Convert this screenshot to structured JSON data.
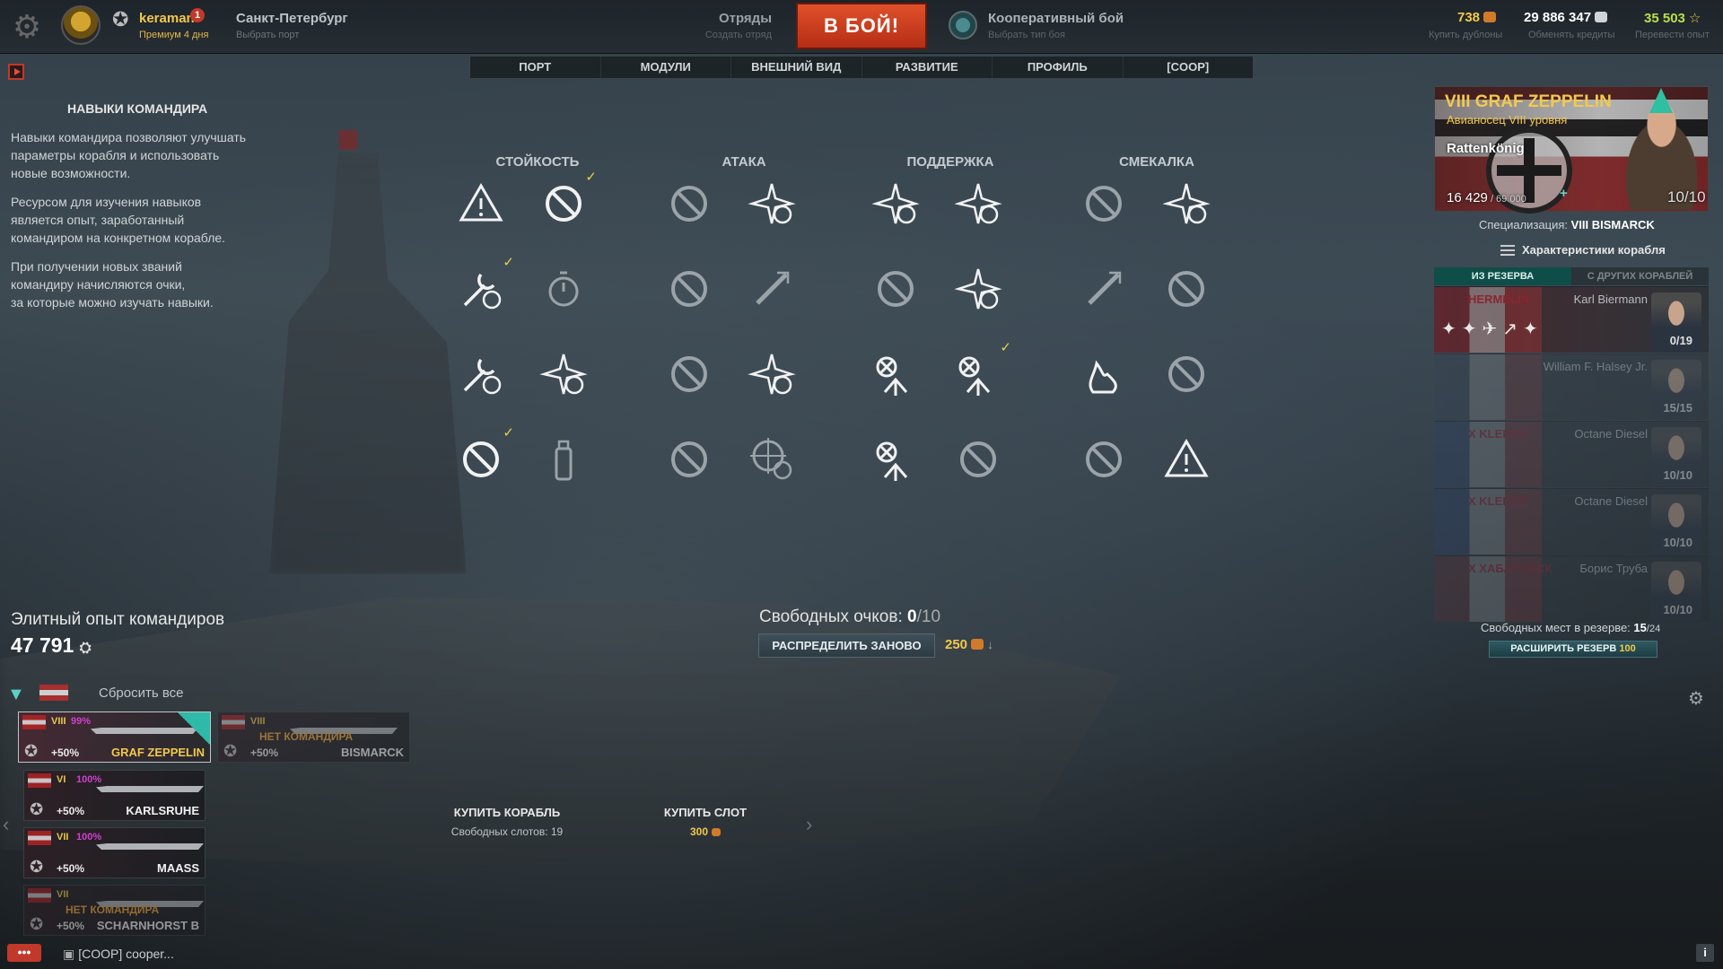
{
  "topbar": {
    "username": "keraman",
    "notification_count": "1",
    "premium": "Премиум 4 дня",
    "port_name": "Санкт-Петербург",
    "port_sub": "Выбрать порт",
    "squads": "Отряды",
    "squads_sub": "Создать отряд",
    "battle_button": "В БОЙ!",
    "mode_name": "Кооперативный бой",
    "mode_sub": "Выбрать тип боя",
    "doubloons": "738",
    "doubloons_sub": "Купить дублоны",
    "credits": "29 886 347",
    "credits_sub": "Обменять кредиты",
    "free_xp": "35 503",
    "free_xp_sub": "Перевести опыт"
  },
  "tabs": [
    "ПОРТ",
    "МОДУЛИ",
    "ВНЕШНИЙ ВИД",
    "РАЗВИТИЕ",
    "ПРОФИЛЬ",
    "[COOP]"
  ],
  "info": {
    "title": "НАВЫКИ КОМАНДИРА",
    "p1_lines": [
      "Навыки командира позволяют улучшать",
      "параметры корабля и использовать",
      "новые возможности."
    ],
    "p2_lines": [
      "Ресурсом для изучения навыков",
      "является опыт, заработанный",
      "командиром на конкретном корабле."
    ],
    "p3_lines": [
      "При получении новых званий",
      "командиру начисляются очки,",
      "за которые можно изучать навыки."
    ]
  },
  "skill_categories": [
    "СТОЙКОСТЬ",
    "АТАКА",
    "ПОДДЕРЖКА",
    "СМЕКАЛКА"
  ],
  "free_points": {
    "label": "Свободных очков:",
    "value": "0",
    "max": "/10"
  },
  "redistribute": {
    "label": "РАСПРЕДЕЛИТЬ ЗАНОВО",
    "cost": "250"
  },
  "elite_xp": {
    "label": "Элитный опыт командиров",
    "value": "47 791"
  },
  "filters": {
    "reset_all": "Сбросить все"
  },
  "ships": [
    {
      "tier": "VIII",
      "pct": "99%",
      "bonus": "+50%",
      "name": "GRAF ZEPPELIN",
      "gold": true,
      "selected": true,
      "no_commander": ""
    },
    {
      "tier": "VIII",
      "pct": "",
      "bonus": "+50%",
      "name": "BISMARCK",
      "gold": false,
      "selected": false,
      "no_commander": "НЕТ КОМАНДИРА"
    },
    {
      "tier": "VI",
      "pct": "100%",
      "bonus": "+50%",
      "name": "KARLSRUHE",
      "gold": false,
      "selected": false,
      "no_commander": ""
    },
    {
      "tier": "VII",
      "pct": "100%",
      "bonus": "+50%",
      "name": "MAASS",
      "gold": false,
      "selected": false,
      "no_commander": ""
    },
    {
      "tier": "VII",
      "pct": "",
      "bonus": "+50%",
      "name": "SCHARNHORST B",
      "gold": false,
      "selected": false,
      "no_commander": "НЕТ КОМАНДИРА"
    }
  ],
  "buy": {
    "buy_ship": "КУПИТЬ КОРАБЛЬ",
    "free_slots": "Свободных слотов: 19",
    "buy_slot": "КУПИТЬ СЛОТ",
    "slot_cost": "300"
  },
  "commander": {
    "ship": "VIII GRAF ZEPPELIN",
    "class": "Авианосец VIII уровня",
    "name": "Rattenkönig",
    "xp": "16 429",
    "xp_max": " / 69 000",
    "points": "10/10",
    "spec_label": "Специализация:",
    "spec_ship": "VIII BISMARCK",
    "characteristics": "Характеристики корабля"
  },
  "reserve_tabs": [
    "ИЗ РЕЗЕРВА",
    "С ДРУГИХ КОРАБЛЕЙ"
  ],
  "reserve": [
    {
      "ship": "HERMELIN",
      "name": "Karl Biermann",
      "points": "0/19",
      "flag": "#8a2530"
    },
    {
      "ship": "",
      "name": "William F. Halsey Jr.",
      "points": "15/15",
      "flag": "#3b5173"
    },
    {
      "ship": "X KLEBER",
      "name": "Octane Diesel",
      "points": "10/10",
      "flag": "#2a4d9a"
    },
    {
      "ship": "X KLEBER",
      "name": "Octane Diesel",
      "points": "10/10",
      "flag": "#2a4d9a"
    },
    {
      "ship": "X ХАБАРОВСК",
      "name": "Борис Труба",
      "points": "10/10",
      "flag": "#8a2530"
    }
  ],
  "reserve_free": {
    "label": "Свободных мест в резерве:",
    "value": "15",
    "max": "/24"
  },
  "expand": {
    "label": "РАСШИРИТЬ РЕЗЕРВ",
    "cost": "100"
  },
  "chat": {
    "text": "[COOP] cooper..."
  }
}
